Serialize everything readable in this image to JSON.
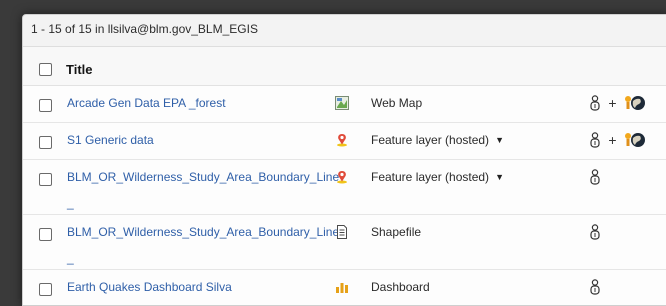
{
  "header": {
    "count_text": "1 - 15 of 15 in llsilva@blm.gov_BLM_EGIS"
  },
  "table": {
    "title_header": "Title",
    "rows": [
      {
        "title": "Arcade Gen Data EPA _forest",
        "title_cont": "",
        "type": "Web Map",
        "type_icon": "web-map-icon",
        "has_dropdown": false,
        "shared": true
      },
      {
        "title": "S1 Generic data",
        "title_cont": "",
        "type": "Feature layer (hosted)",
        "type_icon": "feature-layer-icon",
        "has_dropdown": true,
        "shared": true
      },
      {
        "title": "BLM_OR_Wilderness_Study_Area_Boundary_Line",
        "title_cont": "_",
        "type": "Feature layer (hosted)",
        "type_icon": "feature-layer-icon",
        "has_dropdown": true,
        "shared": false
      },
      {
        "title": "BLM_OR_Wilderness_Study_Area_Boundary_Line",
        "title_cont": "_",
        "type": "Shapefile",
        "type_icon": "shapefile-icon",
        "has_dropdown": false,
        "shared": false
      },
      {
        "title": "Earth Quakes Dashboard Silva",
        "title_cont": "",
        "type": "Dashboard",
        "type_icon": "dashboard-icon",
        "has_dropdown": false,
        "shared": false
      }
    ],
    "plus_symbol": "+",
    "dropdown_caret": "▼"
  },
  "colors": {
    "link": "#2f5fa8",
    "panel_bg": "#f8f8f8",
    "backdrop": "#3a3a3a"
  }
}
